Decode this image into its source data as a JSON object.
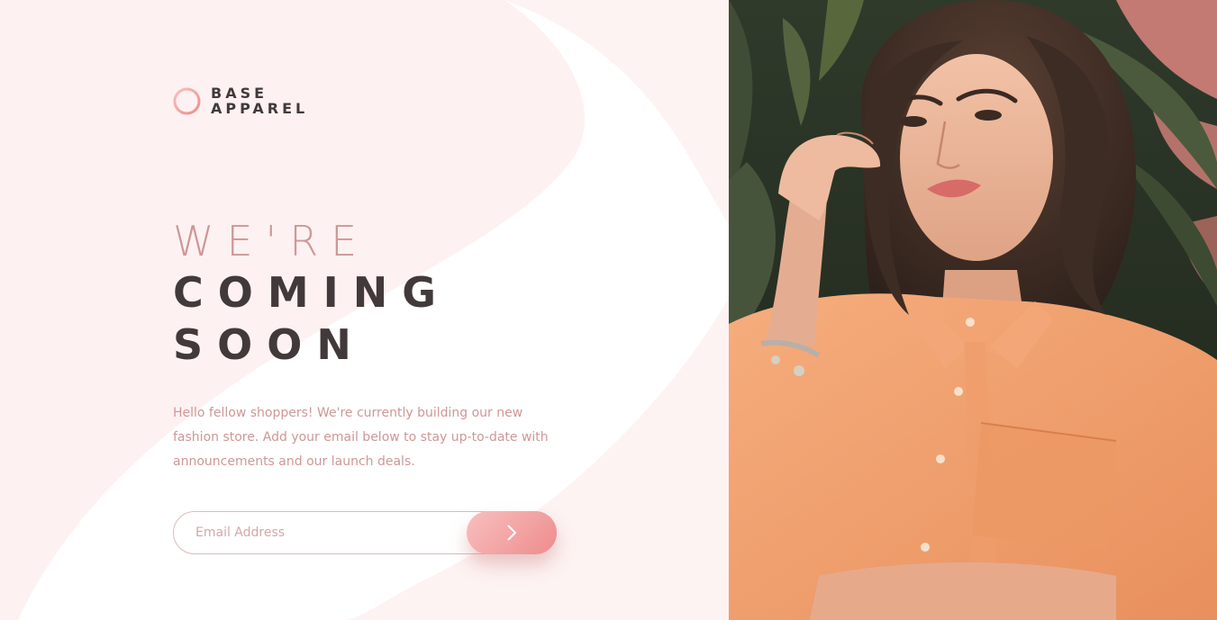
{
  "brand": {
    "line1": "BASE",
    "line2": "APPAREL",
    "logo_icon": "ring-icon"
  },
  "heading": {
    "light": "WE'RE",
    "bold_line1": "COMING",
    "bold_line2": "SOON"
  },
  "description": "Hello fellow shoppers! We're currently building our new fashion store. Add your email below to stay up-to-date with announcements and our launch deals.",
  "form": {
    "email_placeholder": "Email Address",
    "submit_icon": "chevron-right-icon"
  },
  "hero": {
    "alt": "Woman in an orange shirt"
  },
  "colors": {
    "desaturated_red": "#ce9797",
    "dark_grayish_red": "#423a3a",
    "soft_red": "#f96464",
    "gradient_start": "#f8bfbf",
    "gradient_end": "#ee8c8c",
    "background": "#fdf4f3"
  }
}
